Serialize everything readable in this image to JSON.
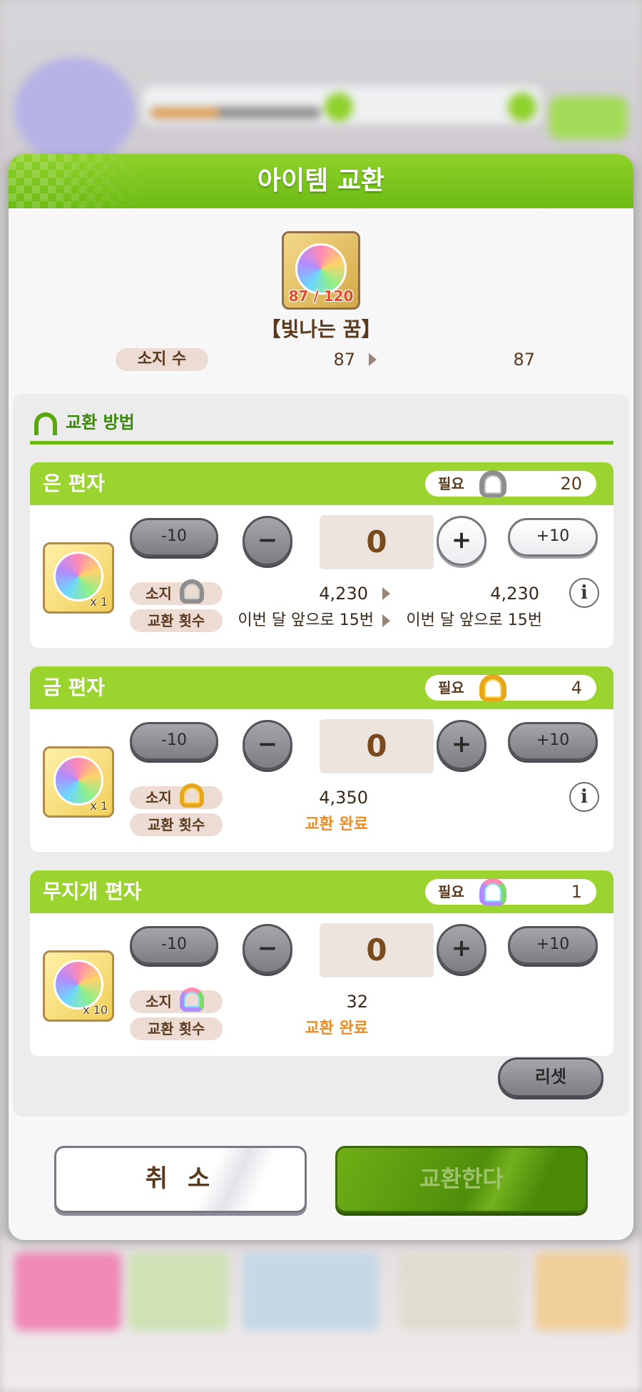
{
  "modal": {
    "title": "아이템 교환",
    "item": {
      "count": "87 / 120",
      "name": "【빛나는 꿈】"
    },
    "owned": {
      "label": "소지 수",
      "before": "87",
      "after": "87"
    }
  },
  "methods": {
    "heading": "교환 방법",
    "cards": [
      {
        "title": "은 편자",
        "need_label": "필요",
        "need_value": "20",
        "currency_icon": "silver-horseshoe-icon",
        "multiplier": "x 1",
        "minus10": "-10",
        "minus": "−",
        "qty": "0",
        "plus": "+",
        "plus10": "+10",
        "own_label": "소지",
        "own_before": "4,230",
        "own_after": "4,230",
        "count_label": "교환 횟수",
        "count_before": "이번 달 앞으로 15번",
        "count_after": "이번 달 앞으로 15번",
        "info": "i"
      },
      {
        "title": "금 편자",
        "need_label": "필요",
        "need_value": "4",
        "currency_icon": "gold-horseshoe-icon",
        "multiplier": "x 1",
        "minus10": "-10",
        "minus": "−",
        "qty": "0",
        "plus": "+",
        "plus10": "+10",
        "own_label": "소지",
        "own_value": "4,350",
        "count_label": "교환 횟수",
        "count_status": "교환 완료",
        "info": "i"
      },
      {
        "title": "무지개 편자",
        "need_label": "필요",
        "need_value": "1",
        "currency_icon": "rainbow-horseshoe-icon",
        "multiplier": "x 10",
        "minus10": "-10",
        "minus": "−",
        "qty": "0",
        "plus": "+",
        "plus10": "+10",
        "own_label": "소지",
        "own_value": "32",
        "count_label": "교환 횟수",
        "count_status": "교환 완료"
      }
    ],
    "reset": "리셋"
  },
  "footer": {
    "cancel": "취 소",
    "exchange": "교환한다"
  },
  "colors": {
    "header_green": "#7cc41e",
    "card_header_green": "#9bd42e",
    "done_orange": "#ee8a1e",
    "qty_bg": "#eee4de"
  }
}
